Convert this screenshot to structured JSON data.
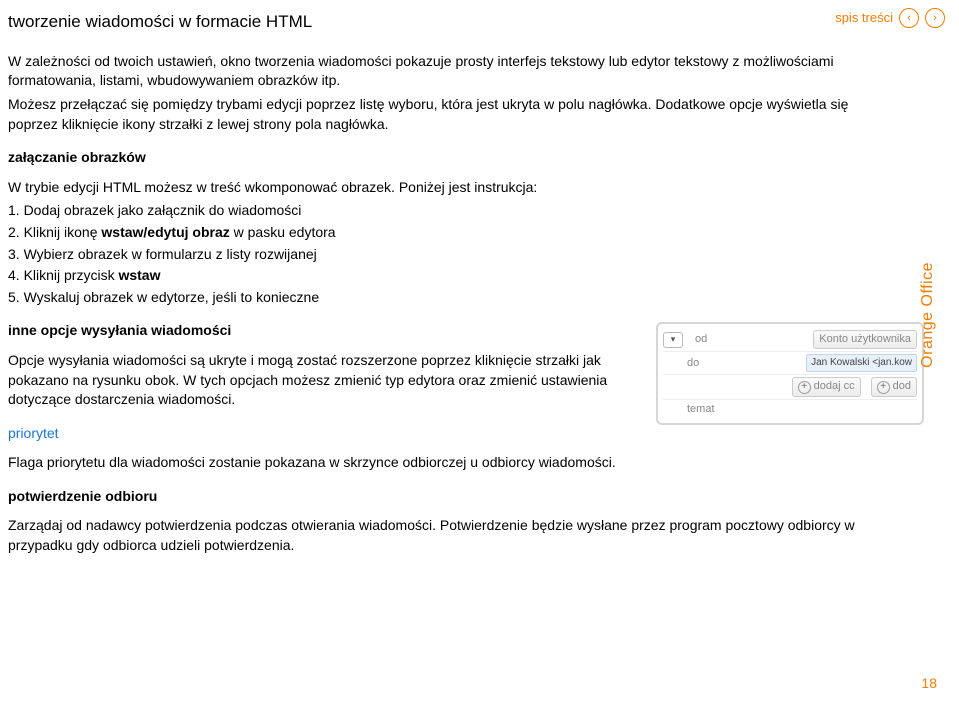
{
  "nav": {
    "toc_label": "spis treści",
    "prev": "‹",
    "next": "›"
  },
  "title": "tworzenie wiadomości w formacie HTML",
  "intro": "W zależności od twoich ustawień, okno tworzenia wiadomości pokazuje prosty interfejs tekstowy lub edytor tekstowy z możliwościami formatowania, listami, wbudowywaniem obrazków itp.",
  "intro2": "Możesz przełączać się pomiędzy trybami edycji poprzez listę wyboru, która jest ukryta w polu nagłówka. Dodatkowe opcje wyświetla się poprzez kliknięcie ikony strzałki z lewej strony pola nagłówka.",
  "attach_head": "załączanie obrazków",
  "attach_intro": "W trybie edycji HTML możesz w treść wkomponować obrazek. Poniżej jest instrukcja:",
  "steps": {
    "s1": "1. Dodaj obrazek jako załącznik do wiadomości",
    "s2_a": "2. Kliknij ikonę ",
    "s2_b": "wstaw/edytuj obraz",
    "s2_c": " w pasku edytora",
    "s3": "3. Wybierz obrazek w formularzu z listy rozwijanej",
    "s4_a": "4. Kliknij przycisk ",
    "s4_b": "wstaw",
    "s5": "5. Wyskaluj obrazek w edytorze, jeśli to konieczne"
  },
  "other_head": "inne opcje wysyłania wiadomości",
  "other_body": "Opcje wysyłania wiadomości są ukryte i mogą zostać rozszerzone poprzez kliknięcie strzałki jak pokazano na rysunku obok. W tych opcjach możesz zmienić typ edytora oraz zmienić ustawienia dotyczące dostarczenia wiadomości.",
  "priority_head": "priorytet",
  "priority_body": "Flaga priorytetu dla wiadomości zostanie pokazana w skrzynce odbiorczej u odbiorcy wiadomości.",
  "confirm_head": "potwierdzenie odbioru",
  "confirm_body": "Zarządaj od nadawcy potwierdzenia podczas otwierania wiadomości. Potwierdzenie będzie wysłane przez program pocztowy odbiorcy w przypadku gdy odbiorca udzieli potwierdzenia.",
  "side_label": "Orange Office",
  "page_number": "18",
  "compose": {
    "od": "od",
    "od_btn": "Konto użytkownika",
    "do": "do",
    "do_val": "Jan  Kowalski <jan.kow",
    "cc_btn": "dodaj cc",
    "dod_btn": "dod",
    "temat": "temat",
    "dropdown_glyph": "▾"
  }
}
